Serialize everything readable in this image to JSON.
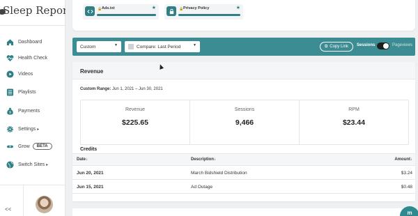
{
  "app": {
    "title": "Sleep Report",
    "colors": {
      "accent": "#3c8d93",
      "sidebar_bg": "#ffffff",
      "page_bg": "#eef0f2"
    }
  },
  "sidebar": {
    "items": [
      {
        "label": "Dashboard",
        "icon": "home-icon"
      },
      {
        "label": "Health Check",
        "icon": "heart-pulse-icon"
      },
      {
        "label": "Videos",
        "icon": "play-circle-icon"
      },
      {
        "label": "Playlists",
        "icon": "list-icon"
      },
      {
        "label": "Payments",
        "icon": "money-bag-icon"
      },
      {
        "label": "Settings",
        "icon": "gear-icon",
        "caret": "▸"
      },
      {
        "label": "Grow",
        "icon": "grow-icon",
        "badge": "BETA"
      },
      {
        "label": "Switch Sites",
        "icon": "globe-icon",
        "caret": "▸"
      }
    ],
    "collapse_label": "<<"
  },
  "docs": [
    {
      "name": "Ads.txt",
      "icon": "code-icon",
      "lock": "🔒",
      "star": "★"
    },
    {
      "name": "Privacy Policy",
      "icon": "lock-icon",
      "lock": "🔒",
      "star": "★"
    }
  ],
  "filters": {
    "range_select": "Custom",
    "compare_select": "Compare: Last Period",
    "copy_link": "Copy Link",
    "sessions_label": "Sessions",
    "pageviews_label": "Pageviews"
  },
  "revenue": {
    "title": "Revenue",
    "range_label": "Custom Range:",
    "range_value": "Jun 1, 2021 – Jun 30, 2021",
    "stats": [
      {
        "label": "Revenue",
        "value": "$225.65"
      },
      {
        "label": "Sessions",
        "value": "9,466"
      },
      {
        "label": "RPM",
        "value": "$23.44"
      }
    ],
    "credits_title": "Credits",
    "columns": {
      "date": "Date↓",
      "description": "Description↓",
      "amount": "Amount↓"
    },
    "rows": [
      {
        "date": "Jun 20, 2021",
        "description": "March Bidshield Distribution",
        "amount": "$3.24"
      },
      {
        "date": "Jun 15, 2021",
        "description": "Ad Outage",
        "amount": "$0.48"
      }
    ]
  }
}
